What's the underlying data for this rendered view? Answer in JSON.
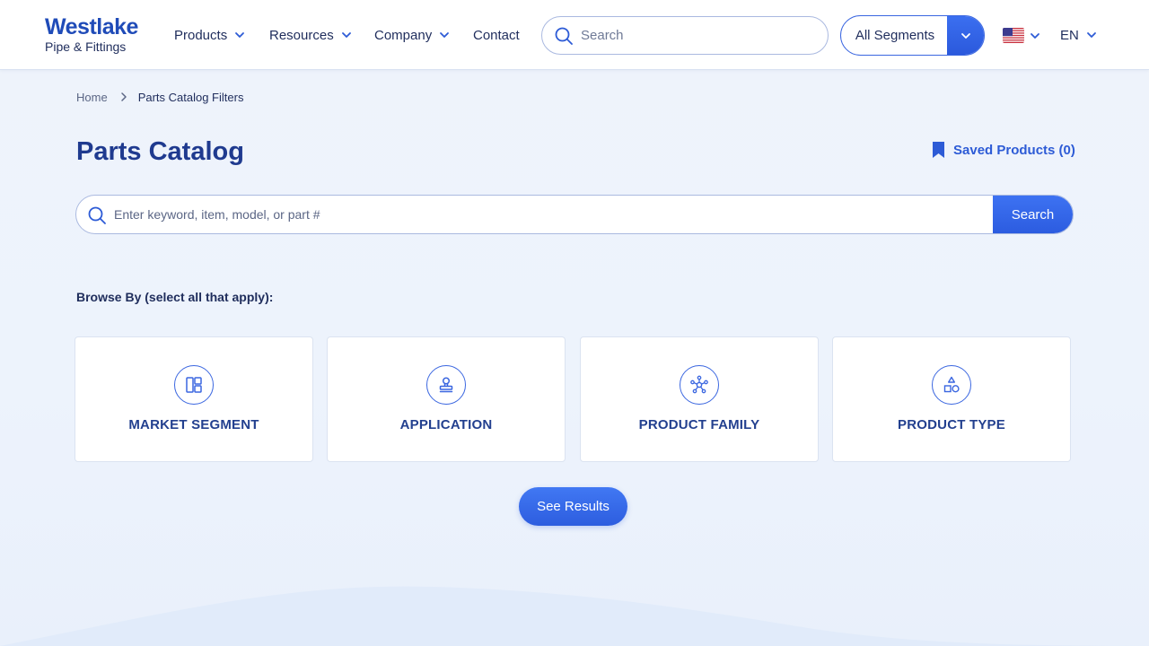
{
  "brand": {
    "name": "Westlake",
    "tagline": "Pipe & Fittings"
  },
  "nav": {
    "items": [
      {
        "label": "Products",
        "has_dropdown": true
      },
      {
        "label": "Resources",
        "has_dropdown": true
      },
      {
        "label": "Company",
        "has_dropdown": true
      },
      {
        "label": "Contact",
        "has_dropdown": false
      }
    ]
  },
  "header_search": {
    "placeholder": "Search"
  },
  "segment_select": {
    "selected": "All Segments"
  },
  "region": {
    "flag": "us-flag-icon"
  },
  "language": {
    "selected": "EN"
  },
  "breadcrumb": {
    "home": "Home",
    "current": "Parts Catalog Filters"
  },
  "page": {
    "title": "Parts Catalog",
    "saved_products": "Saved Products (0)"
  },
  "catalog_search": {
    "placeholder": "Enter keyword, item, model, or part #",
    "button": "Search"
  },
  "browse": {
    "label": "Browse By (select all that apply):",
    "cards": [
      {
        "label": "MARKET SEGMENT",
        "icon": "layout-grid-icon"
      },
      {
        "label": "APPLICATION",
        "icon": "stamp-icon"
      },
      {
        "label": "PRODUCT FAMILY",
        "icon": "network-icon"
      },
      {
        "label": "PRODUCT TYPE",
        "icon": "shapes-icon"
      }
    ]
  },
  "actions": {
    "see_results": "See Results"
  },
  "colors": {
    "accent": "#2d5bd6",
    "title": "#1f3a8f",
    "background": "#edf3fc"
  }
}
